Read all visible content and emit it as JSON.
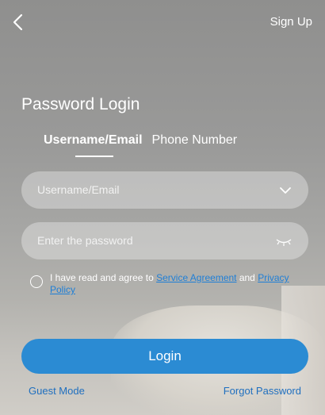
{
  "header": {
    "signup_label": "Sign Up"
  },
  "page": {
    "title": "Password Login",
    "tabs": [
      {
        "label": "Username/Email"
      },
      {
        "label": "Phone Number"
      }
    ]
  },
  "form": {
    "username_placeholder": "Username/Email",
    "password_placeholder": "Enter the password",
    "agree_prefix": "I have read and agree to ",
    "service_link": "Service Agreement",
    "and_text": " and ",
    "privacy_link": "Privacy Policy",
    "login_label": "Login"
  },
  "footer": {
    "guest_label": "Guest Mode",
    "forgot_label": "Forgot Password"
  },
  "icons": {
    "back": "back-chevron-icon",
    "dropdown": "chevron-down-icon",
    "password_toggle": "eye-closed-icon",
    "agree_radio": "radio-icon"
  },
  "colors": {
    "accent": "#2b8bd3",
    "link": "#1f6fbf"
  }
}
